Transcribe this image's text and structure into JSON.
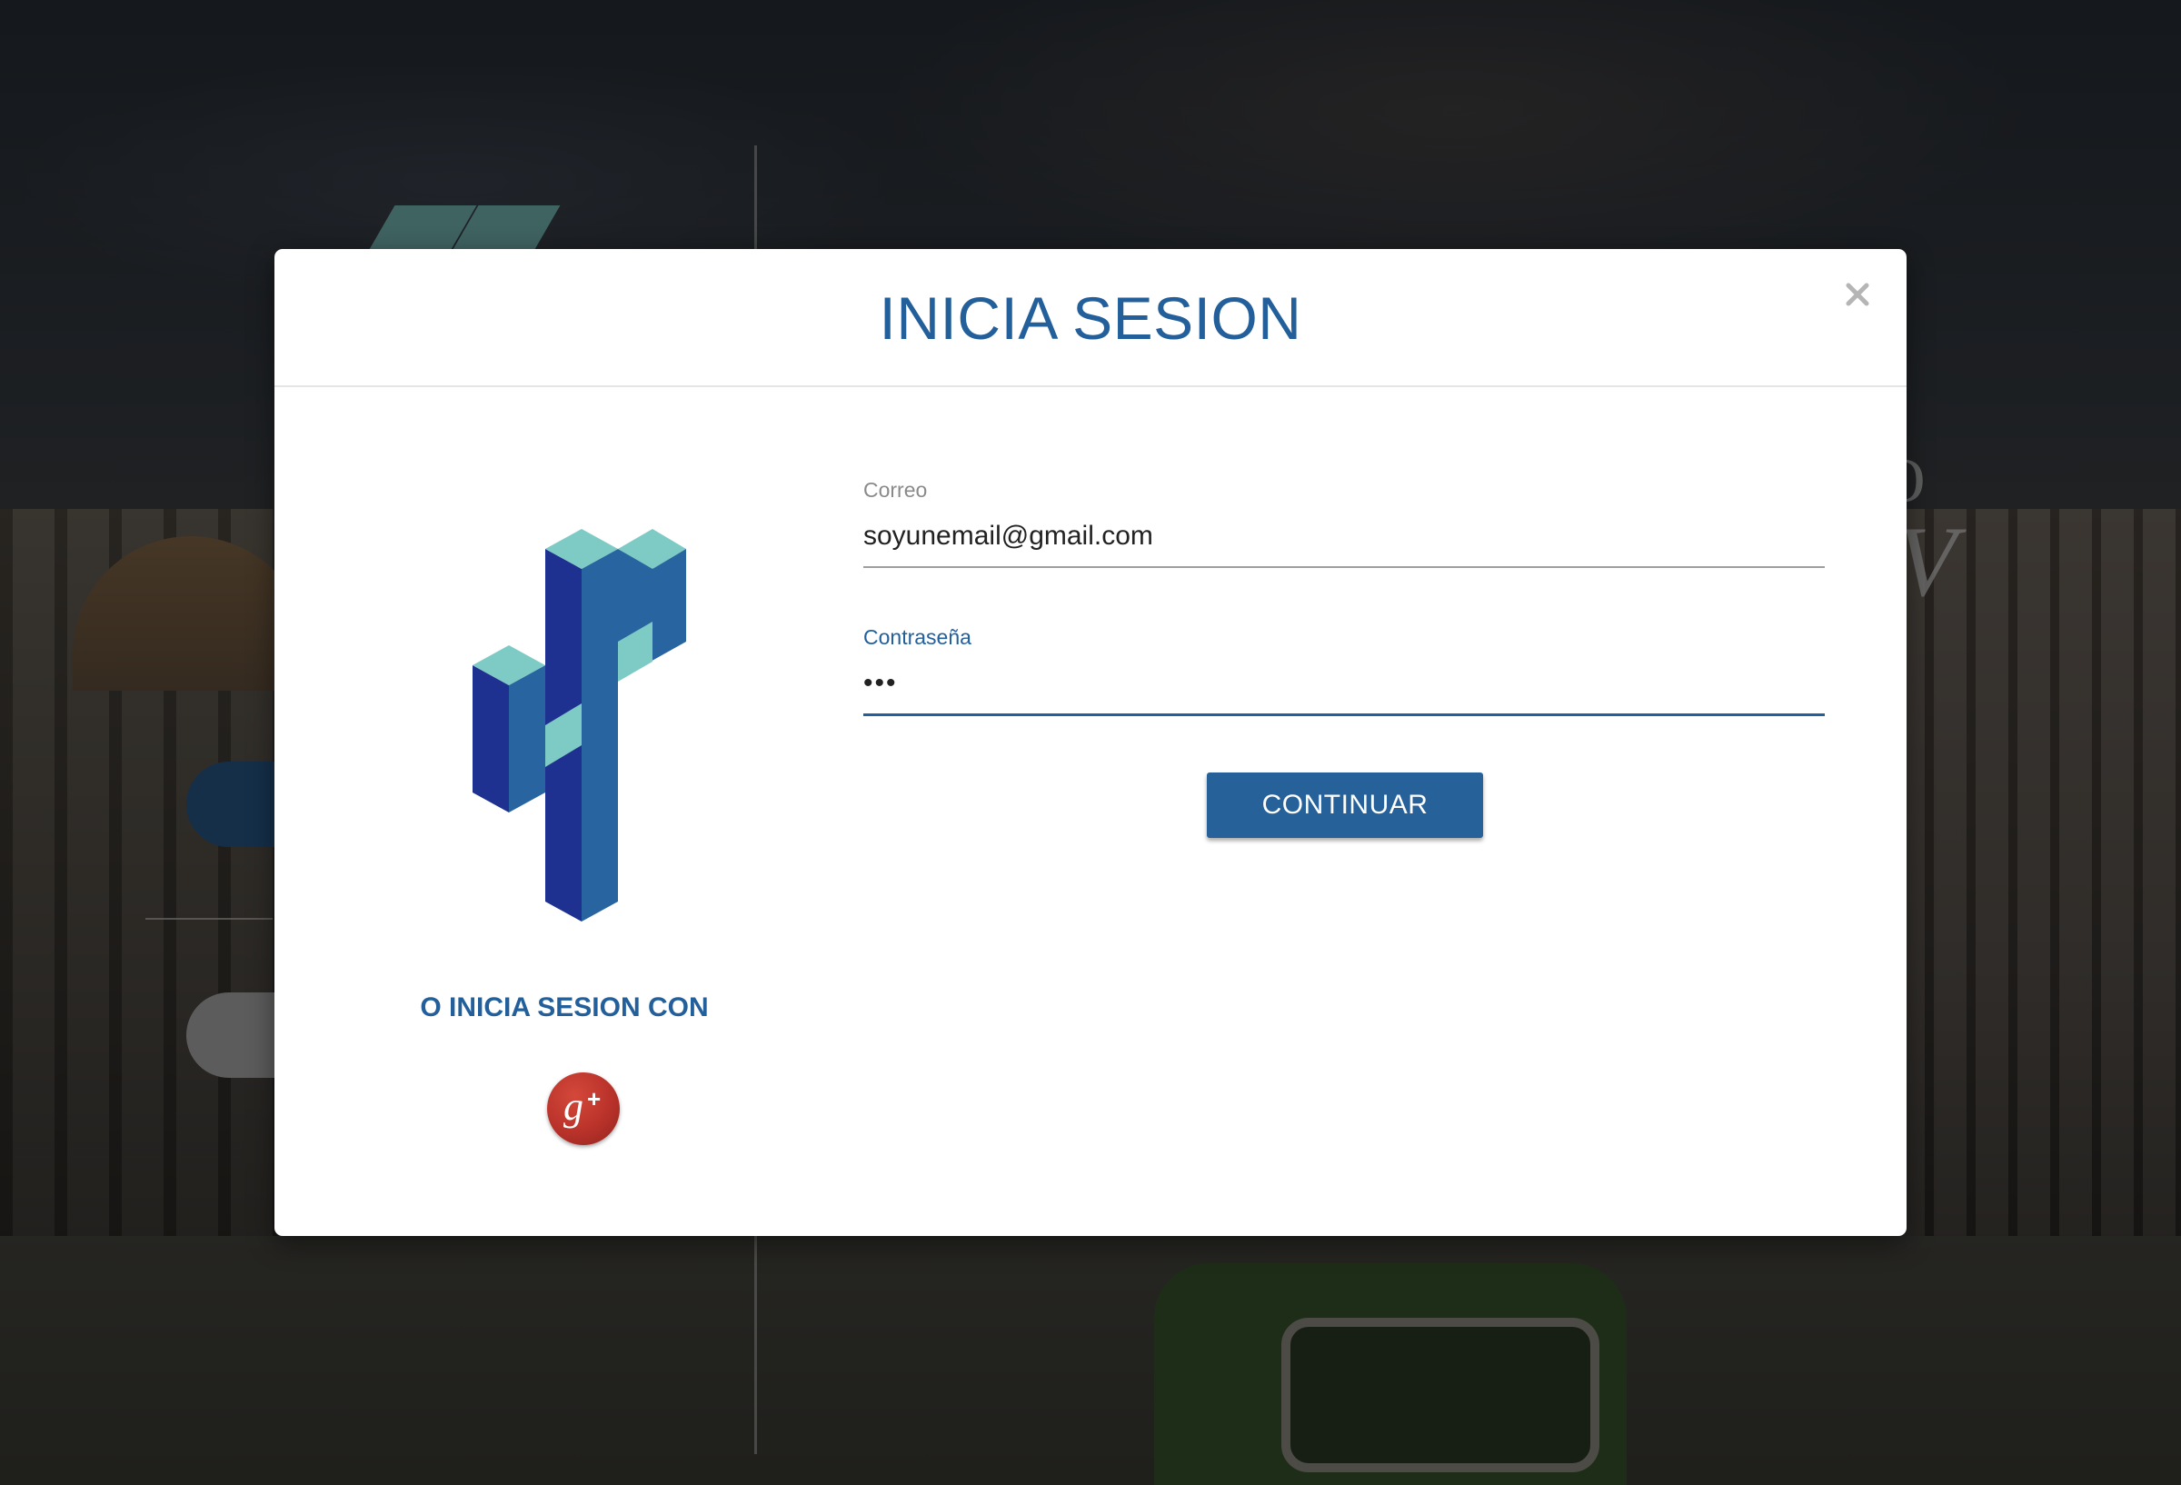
{
  "modal": {
    "title": "INICIA SESION",
    "close_icon": "close-icon"
  },
  "form": {
    "email": {
      "label": "Correo",
      "value": "soyunemail@gmail.com"
    },
    "password": {
      "label": "Contraseña",
      "value": "•••"
    },
    "submit_label": "CONTINUAR"
  },
  "social": {
    "label": "O INICIA SESION CON",
    "google_plus_icon": "google-plus-icon"
  },
  "colors": {
    "brand_blue": "#23609b",
    "logo_dark": "#1f3190",
    "logo_mid": "#2764a0",
    "logo_teal": "#7ecac5",
    "google_red": "#c0392b",
    "backdrop": "rgba(0,0,0,0.5)"
  }
}
